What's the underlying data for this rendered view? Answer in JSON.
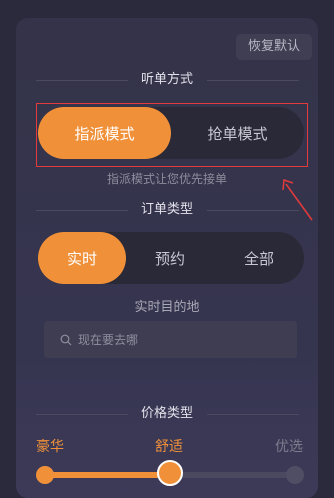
{
  "header": {
    "reset_label": "恢复默认"
  },
  "listen_mode": {
    "title": "听单方式",
    "options": [
      "指派模式",
      "抢单模式"
    ],
    "selected": "指派模式",
    "hint": "指派模式让您优先接单"
  },
  "order_type": {
    "title": "订单类型",
    "options": [
      "实时",
      "预约",
      "全部"
    ],
    "selected": "实时"
  },
  "destination": {
    "title": "实时目的地",
    "placeholder": "现在要去哪"
  },
  "price_type": {
    "title": "价格类型",
    "options": [
      "豪华",
      "舒适",
      "优选"
    ],
    "selected": "舒适"
  },
  "colors": {
    "accent": "#f0913a",
    "annotation": "#e23b3b"
  }
}
